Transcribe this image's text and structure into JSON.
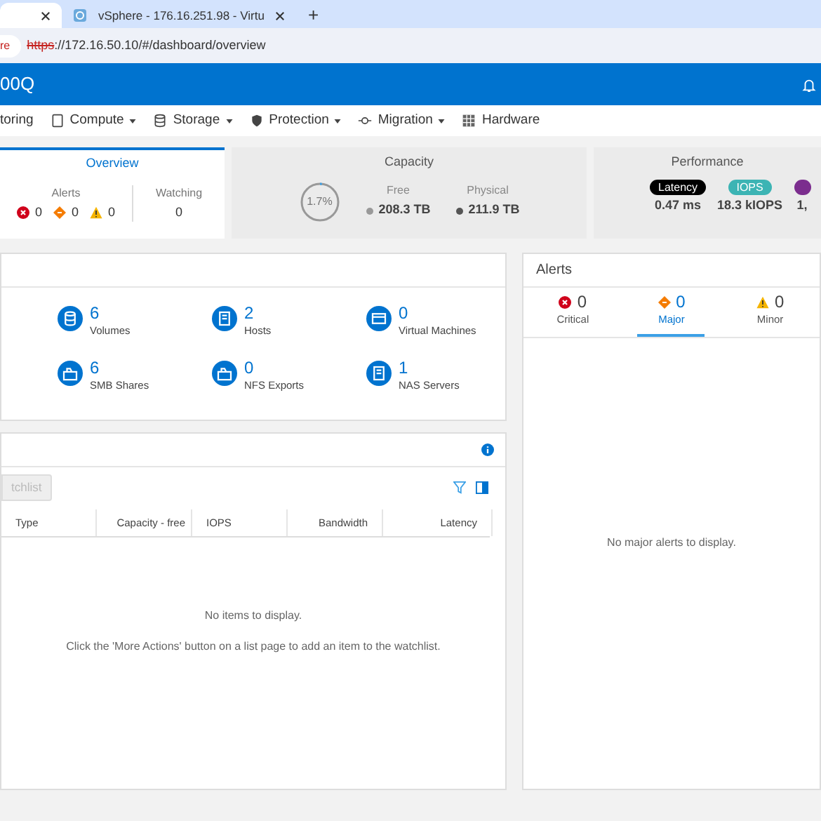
{
  "browser": {
    "tabs": [
      {
        "selected": true
      },
      {
        "title": "vSphere - 176.16.251.98 - Virtu",
        "selected": false
      }
    ],
    "new_tab": "+",
    "security_badge": "re",
    "url_scheme": "https",
    "url_rest": "://172.16.50.10/#/dashboard/overview"
  },
  "header": {
    "title": "00Q"
  },
  "nav": [
    {
      "label": "toring",
      "dropdown": false
    },
    {
      "label": "Compute",
      "dropdown": true
    },
    {
      "label": "Storage",
      "dropdown": true
    },
    {
      "label": "Protection",
      "dropdown": true
    },
    {
      "label": "Migration",
      "dropdown": true
    },
    {
      "label": "Hardware",
      "dropdown": false
    }
  ],
  "summary": {
    "overview": {
      "title": "Overview",
      "selected": true,
      "alerts_label": "Alerts",
      "alerts": [
        {
          "kind": "critical",
          "count": "0"
        },
        {
          "kind": "major",
          "count": "0"
        },
        {
          "kind": "minor",
          "count": "0"
        }
      ],
      "watching_label": "Watching",
      "watching": "0"
    },
    "capacity": {
      "title": "Capacity",
      "ring_text": "1.7%",
      "level": 0.017,
      "free_label": "Free",
      "free": "208.3 TB",
      "physical_label": "Physical",
      "physical": "211.9 TB"
    },
    "performance": {
      "title": "Performance",
      "metrics": [
        {
          "label": "Latency",
          "value": "0.47 ms",
          "color": "#000000"
        },
        {
          "label": "IOPS",
          "value": "18.3 kIOPS",
          "color": "#3cb4b4"
        },
        {
          "value": "1,",
          "color": "#7b2d8e"
        }
      ]
    }
  },
  "inventory": [
    {
      "count": "6",
      "label": "Volumes"
    },
    {
      "count": "2",
      "label": "Hosts"
    },
    {
      "count": "0",
      "label": "Virtual Machines"
    },
    {
      "count": "6",
      "label": "SMB Shares"
    },
    {
      "count": "0",
      "label": "NFS Exports"
    },
    {
      "count": "1",
      "label": "NAS Servers"
    }
  ],
  "watchlist": {
    "button": "tchlist",
    "columns": [
      "Type",
      "Capacity - free",
      "IOPS",
      "Bandwidth",
      "Latency"
    ],
    "empty": "No items to display.",
    "hint": "Click the 'More Actions' button on a list page to add an item to the watchlist."
  },
  "alerts_panel": {
    "title": "Alerts",
    "tabs": [
      {
        "kind": "critical",
        "count": "0",
        "label": "Critical",
        "selected": false
      },
      {
        "kind": "major",
        "count": "0",
        "label": "Major",
        "selected": true
      },
      {
        "kind": "minor",
        "count": "0",
        "label": "Minor",
        "selected": false
      }
    ],
    "empty": "No major alerts to display."
  }
}
